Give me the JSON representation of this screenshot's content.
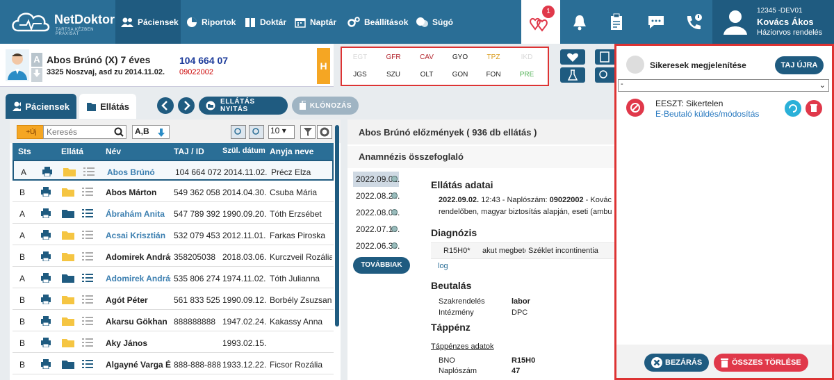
{
  "app": {
    "name": "NetDoktor",
    "tagline": "TARTSA KÉZBEN PRAXISÁT"
  },
  "nav": [
    {
      "label": "Páciensek",
      "active": true
    },
    {
      "label": "Riportok"
    },
    {
      "label": "Doktár"
    },
    {
      "label": "Naptár"
    },
    {
      "label": "Beállítások"
    },
    {
      "label": "Súgó"
    }
  ],
  "notification_count": "1",
  "user": {
    "id": "12345 -DEV01",
    "name": "Kovács Ákos",
    "role": "Háziorvos rendelés"
  },
  "patient": {
    "name": "Abos Brúnó (X)",
    "age": "7 éves",
    "address": "3325 Noszvaj, asd zu 2014.11.02.",
    "taj": "104 664 07",
    "number": "09022002",
    "badge_a": "A",
    "badge_h": "H"
  },
  "codes": {
    "row1": [
      {
        "label": "EGT",
        "color": "#d9d9d9"
      },
      {
        "label": "GFR",
        "color": "#b3262e"
      },
      {
        "label": "CAV",
        "color": "#b3262e"
      },
      {
        "label": "GYO",
        "color": "#222222"
      },
      {
        "label": "TPZ",
        "color": "#d99a1a"
      },
      {
        "label": "IKD",
        "color": "#d9d9d9"
      }
    ],
    "row2": [
      {
        "label": "JGS",
        "color": "#222222"
      },
      {
        "label": "SZU",
        "color": "#222222"
      },
      {
        "label": "OLT",
        "color": "#222222"
      },
      {
        "label": "GON",
        "color": "#222222"
      },
      {
        "label": "FON",
        "color": "#222222"
      },
      {
        "label": "PRE",
        "color": "#4caf50"
      }
    ]
  },
  "tabs": [
    {
      "label": "Páciensek",
      "active": true
    },
    {
      "label": "Ellátás"
    }
  ],
  "actions": {
    "open": "ELLÁTÁS NYITÁS",
    "clone": "KLÓNOZÁS"
  },
  "list": {
    "new_label": "+Új",
    "search_placeholder": "Keresés",
    "sort_label": "A,B",
    "page_size": "10",
    "columns": [
      "Sts",
      "Ellátá",
      "Név",
      "TAJ / ID",
      "Szül. dátum",
      "Anyja neve"
    ],
    "rows": [
      {
        "sts": "A",
        "name": "Abos Brúnó",
        "taj": "104 664 072",
        "dob": "2014.11.02.",
        "mother": "Précz Elza",
        "link": true,
        "selected": true
      },
      {
        "sts": "B",
        "name": "Abos Márton",
        "taj": "549 362 058",
        "dob": "2014.04.30.",
        "mother": "Csuba Mária",
        "link": false
      },
      {
        "sts": "A",
        "name": "Ábrahám Anita",
        "taj": "547 789 392",
        "dob": "1990.09.20.",
        "mother": "Tóth Erzsébet",
        "link": true,
        "dark": true
      },
      {
        "sts": "A",
        "name": "Acsai Krisztián",
        "taj": "532 079 453",
        "dob": "2012.11.01.",
        "mother": "Farkas Piroska",
        "link": true
      },
      {
        "sts": "B",
        "name": "Adomirek András",
        "taj": "358205038",
        "dob": "2018.03.06.",
        "mother": "Kurczveil Rozália",
        "link": false
      },
      {
        "sts": "A",
        "name": "Adomirek András",
        "taj": "535 806 274",
        "dob": "1974.11.02.",
        "mother": "Tóth Julianna",
        "link": true,
        "dark": true
      },
      {
        "sts": "B",
        "name": "Agót Péter",
        "taj": "561 833 525",
        "dob": "1990.09.12.",
        "mother": "Borbély Zsuzsanna",
        "link": false
      },
      {
        "sts": "B",
        "name": "Akarsu Gökhan",
        "taj": "888888888",
        "dob": "1947.02.24.",
        "mother": "Kakassy Anna",
        "link": false
      },
      {
        "sts": "B",
        "name": "Aky János",
        "taj": "",
        "dob": "1993.02.15.",
        "mother": "",
        "link": false
      },
      {
        "sts": "B",
        "name": "Algayné Varga Év",
        "taj": "888-888-888",
        "dob": "1933.12.22.",
        "mother": "Ficsor Rozália",
        "link": false,
        "dark": true
      }
    ]
  },
  "detail": {
    "header": "Abos Brúnó előzmények ( 936 db ellátás )",
    "anamnesis": "Anamnézis összefoglaló",
    "dates": [
      "2022.09.02.",
      "2022.08.24.",
      "2022.08.03.",
      "2022.07.19.",
      "2022.06.30."
    ],
    "more": "TOVÁBBIAK",
    "care_title": "Ellátás adatai",
    "care_date": "2022.09.02.",
    "care_line1": "12:43 - Naplószám:",
    "care_num": "09022002",
    "care_line1_tail": "- Kovác",
    "care_line2": "rendelőben, magyar biztosítás alapján, eseti (ambu",
    "diag_title": "Diagnózis",
    "diag_code": "R15H0*",
    "diag_text": "akut megbete",
    "diag_text2": "Széklet incontinentia",
    "log": "log",
    "ref_title": "Beutalás",
    "ref_rows": [
      [
        "Szakrendelés",
        "labor"
      ],
      [
        "Intézmény",
        "DPC"
      ]
    ],
    "sick_title": "Táppénz",
    "sick_link": "Táppénzes adatok",
    "sick_rows": [
      [
        "BNO",
        "R15H0"
      ],
      [
        "Naplószám",
        "47"
      ]
    ]
  },
  "notif": {
    "success_label": "Sikeresek megjelenítése",
    "taj_button": "TAJ ÚJRA",
    "select_value": "-",
    "item_title": "EESZT: Sikertelen",
    "item_subtitle": "E-Beutaló küldés/módosítás",
    "close": "BEZÁRÁS",
    "delete_all": "ÖSSZES TÖRLÉSE"
  },
  "colors": {
    "primary": "#2a6e96",
    "dark": "#1f5b80",
    "alert": "#e0384a",
    "orange": "#f5a623"
  }
}
